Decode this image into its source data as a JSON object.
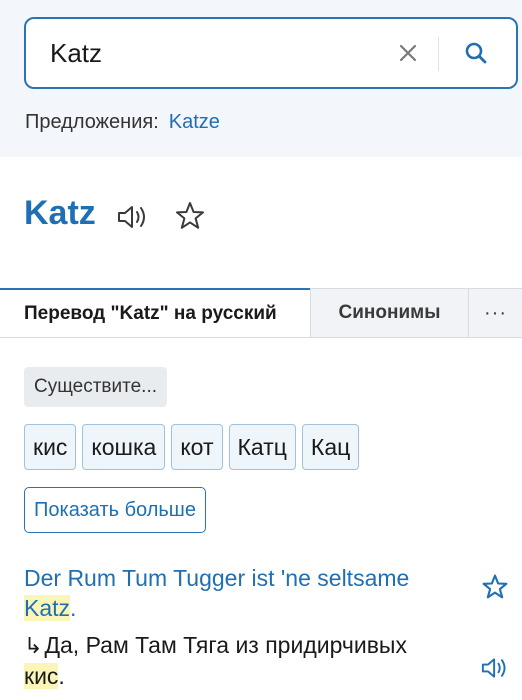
{
  "search": {
    "query": "Katz",
    "clear_icon": "close-icon",
    "search_icon": "search-icon"
  },
  "suggestions": {
    "label": "Предложения:",
    "items": [
      "Katze"
    ]
  },
  "entry": {
    "headword": "Katz",
    "audio_icon": "speaker-icon",
    "favorite_icon": "star-icon"
  },
  "tabs": [
    {
      "label": "Перевод \"Katz\" на русский",
      "active": true
    },
    {
      "label": "Синонимы",
      "active": false
    },
    {
      "label": "···",
      "active": false
    }
  ],
  "part_of_speech": "Существите...",
  "translations": [
    "кис",
    "кошка",
    "кот",
    "Катц",
    "Кац"
  ],
  "show_more_label": "Показать больше",
  "example": {
    "source_before": "Der Rum Tum Tugger ist 'ne seltsame ",
    "source_highlight": "Katz",
    "source_after": ".",
    "arrow": "↳",
    "target_before": "Да, Рам Там Тяга из придирчивых ",
    "target_highlight": "кис",
    "target_after": "."
  },
  "colors": {
    "accent": "#1e6fb3",
    "border_accent": "#2a74b5",
    "highlight": "#fbf6b8",
    "chip_bg": "#eef5fb"
  }
}
